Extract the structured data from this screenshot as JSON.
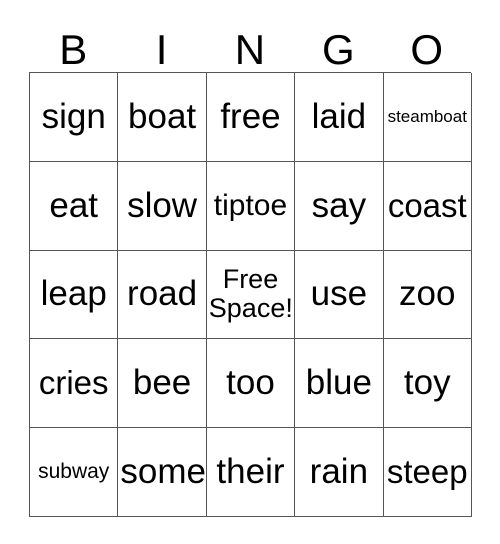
{
  "card": {
    "title": "BINGO",
    "header_letters": [
      "B",
      "I",
      "N",
      "G",
      "O"
    ],
    "rows": [
      [
        {
          "text": "sign",
          "size": "s-xl"
        },
        {
          "text": "boat",
          "size": "s-xl"
        },
        {
          "text": "free",
          "size": "s-xl"
        },
        {
          "text": "laid",
          "size": "s-xl"
        },
        {
          "text": "steamboat",
          "size": "s-xs"
        }
      ],
      [
        {
          "text": "eat",
          "size": "s-xl"
        },
        {
          "text": "slow",
          "size": "s-xl"
        },
        {
          "text": "tiptoe",
          "size": "s-md"
        },
        {
          "text": "say",
          "size": "s-xl"
        },
        {
          "text": "coast",
          "size": "s-lg"
        }
      ],
      [
        {
          "text": "leap",
          "size": "s-xl"
        },
        {
          "text": "road",
          "size": "s-xl"
        },
        {
          "text": "Free\nSpace!",
          "size": "s-free"
        },
        {
          "text": "use",
          "size": "s-xl"
        },
        {
          "text": "zoo",
          "size": "s-xl"
        }
      ],
      [
        {
          "text": "cries",
          "size": "s-lg"
        },
        {
          "text": "bee",
          "size": "s-xl"
        },
        {
          "text": "too",
          "size": "s-xl"
        },
        {
          "text": "blue",
          "size": "s-xl"
        },
        {
          "text": "toy",
          "size": "s-xl"
        }
      ],
      [
        {
          "text": "subway",
          "size": "s-sm"
        },
        {
          "text": "some",
          "size": "s-xl"
        },
        {
          "text": "their",
          "size": "s-xl"
        },
        {
          "text": "rain",
          "size": "s-xl"
        },
        {
          "text": "steep",
          "size": "s-lg"
        }
      ]
    ],
    "free_space_index": {
      "row": 2,
      "col": 2
    },
    "colors": {
      "background": "#ffffff",
      "text": "#000000",
      "grid_line": "#555555"
    }
  }
}
